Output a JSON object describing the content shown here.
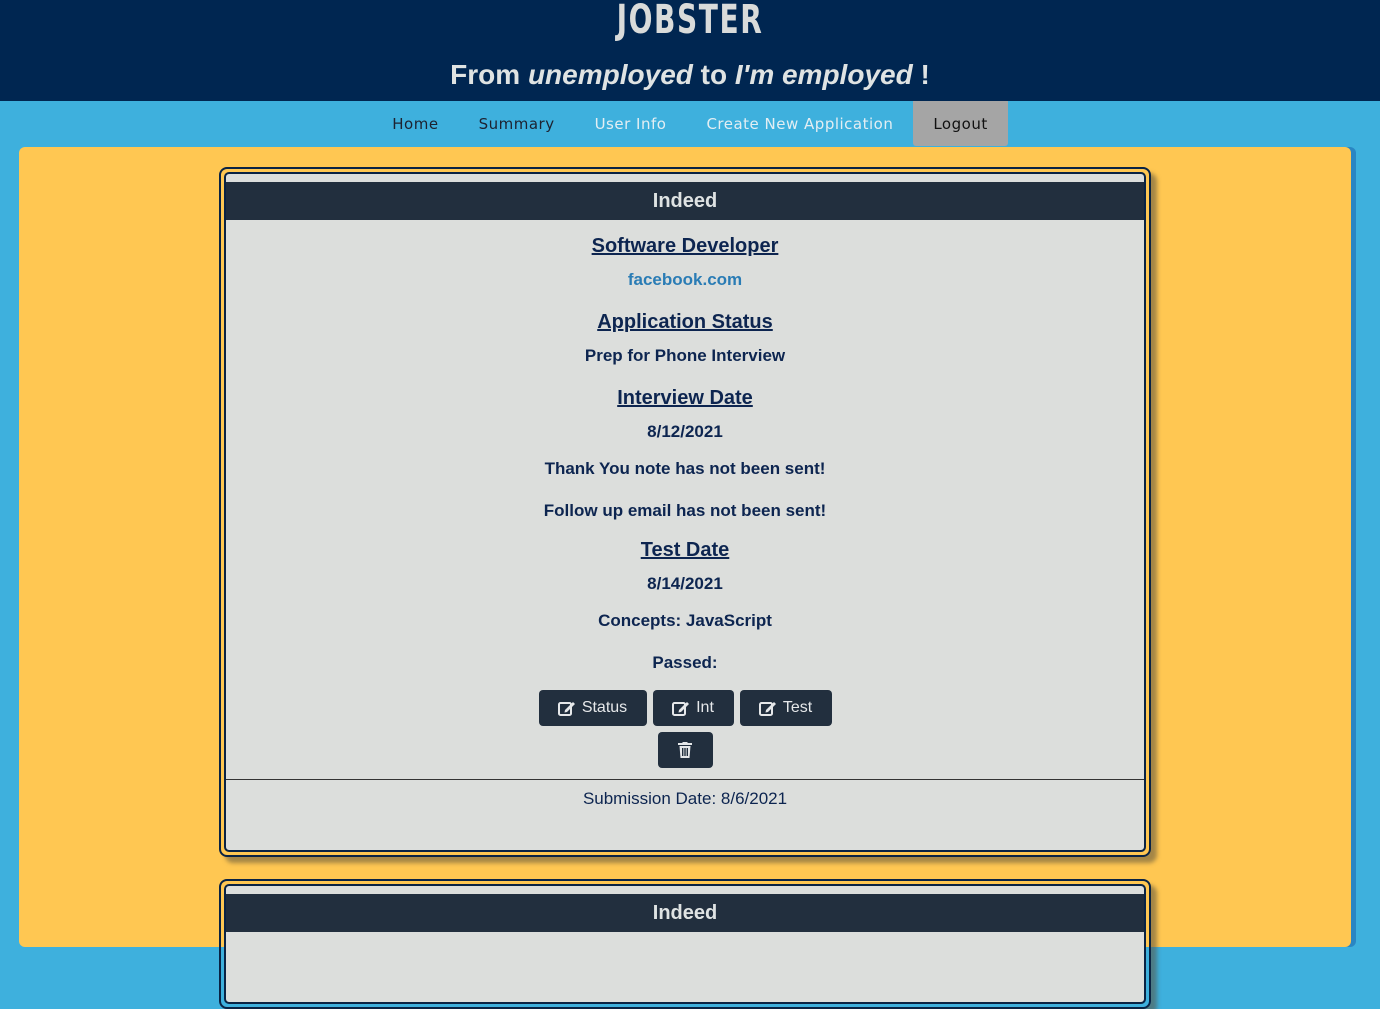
{
  "header": {
    "logo": "JOBSTER",
    "tagline": {
      "part1": "From ",
      "emph1": "unemployed",
      "part2": " to ",
      "emph2": "I'm employed",
      "part3": " !"
    }
  },
  "nav": {
    "items": [
      {
        "label": "Home"
      },
      {
        "label": "Summary"
      },
      {
        "label": "User Info"
      },
      {
        "label": "Create New Application"
      },
      {
        "label": "Logout"
      }
    ]
  },
  "cards": [
    {
      "source": "Indeed",
      "job_title": "Software Developer",
      "company_link": "facebook.com",
      "status_heading": "Application Status",
      "status": "Prep for Phone Interview",
      "interview_heading": "Interview Date",
      "interview_date": "8/12/2021",
      "thank_you": "Thank You note has not been sent!",
      "follow_up": "Follow up email has not been sent!",
      "test_heading": "Test Date",
      "test_date": "8/14/2021",
      "concepts": "Concepts: JavaScript",
      "passed": "Passed:",
      "buttons": {
        "status": "Status",
        "int": "Int",
        "test": "Test"
      },
      "submission": "Submission Date: 8/6/2021"
    },
    {
      "source": "Indeed"
    }
  ],
  "colors": {
    "page_bg": "#3eb0dd",
    "header_bg": "#002651",
    "main_bg": "#ffc752",
    "card_head": "#222f3e",
    "card_bg": "#dcdedc"
  },
  "icons": {
    "edit": "edit-icon",
    "delete": "trash-icon"
  }
}
